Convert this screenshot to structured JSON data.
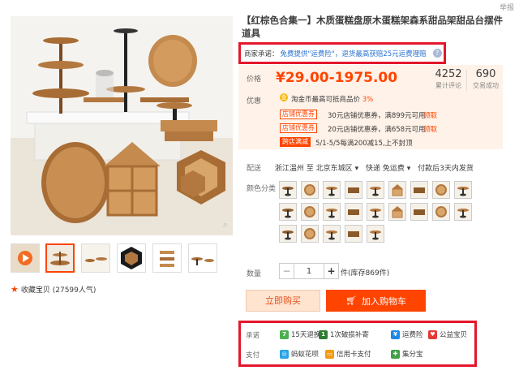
{
  "report": "举报",
  "title": "【红棕色合集一】木质蛋糕盘原木蛋糕架森系甜品架甜品台摆件道具",
  "promise": {
    "label": "商家承诺：",
    "text": "免费提供\"运费险\"，退货最高获赔25元运费理赔",
    "help_icon": "question-icon"
  },
  "price": {
    "label": "价格",
    "value": "¥29.00-1975.00",
    "reviews_count": "4252",
    "reviews_label": "累计评论",
    "sales_count": "690",
    "sales_label": "交易成功"
  },
  "promo": {
    "label": "优惠",
    "coin_text": "淘金币最高可抵商品价",
    "coin_pct": "3%",
    "coupons": [
      {
        "tag": "店铺优惠券",
        "text": "30元店铺优惠券，满899元可用",
        "link": "领取"
      },
      {
        "tag": "店铺优惠券",
        "text": "20元店铺优惠券，满658元可用",
        "link": "领取"
      }
    ],
    "full_reduction": {
      "tag": "跨店满减",
      "text": "5/1-5/5每满200减15,上不封顶"
    }
  },
  "shipping": {
    "label": "配送",
    "from": "浙江温州",
    "to_label": "至",
    "to": "北京东城区",
    "method": "快递 免运费",
    "time": "付款后3天内发货"
  },
  "color": {
    "label": "颜色分类",
    "count": 23
  },
  "quantity": {
    "label": "数量",
    "value": "1",
    "stock": "件(库存869件)",
    "minus": "−",
    "plus": "+"
  },
  "actions": {
    "buy_now": "立即购买",
    "add_cart": "加入购物车"
  },
  "favorites": "收藏宝贝 (27599人气)",
  "services": {
    "promise_label": "承诺",
    "pay_label": "支付",
    "promise_items": [
      {
        "icon": "7",
        "text": "15天退换",
        "color": "#4caf50"
      },
      {
        "icon": "1",
        "text": "1次破损补寄",
        "color": "#2e7d32"
      },
      {
        "icon": "¥",
        "text": "运费险",
        "color": "#1e88e5"
      },
      {
        "icon": "♥",
        "text": "公益宝贝",
        "color": "#e53935"
      }
    ],
    "pay_items": [
      {
        "icon": "◎",
        "text": "蚂蚁花呗",
        "color": "#29a3e6"
      },
      {
        "icon": "▭",
        "text": "信用卡支付",
        "color": "#f39c12"
      },
      {
        "icon": "✚",
        "text": "集分宝",
        "color": "#43a047"
      }
    ]
  },
  "colors": {
    "accent": "#ff4400",
    "highlight_box": "#e4172c",
    "link": "#2a71d0"
  }
}
